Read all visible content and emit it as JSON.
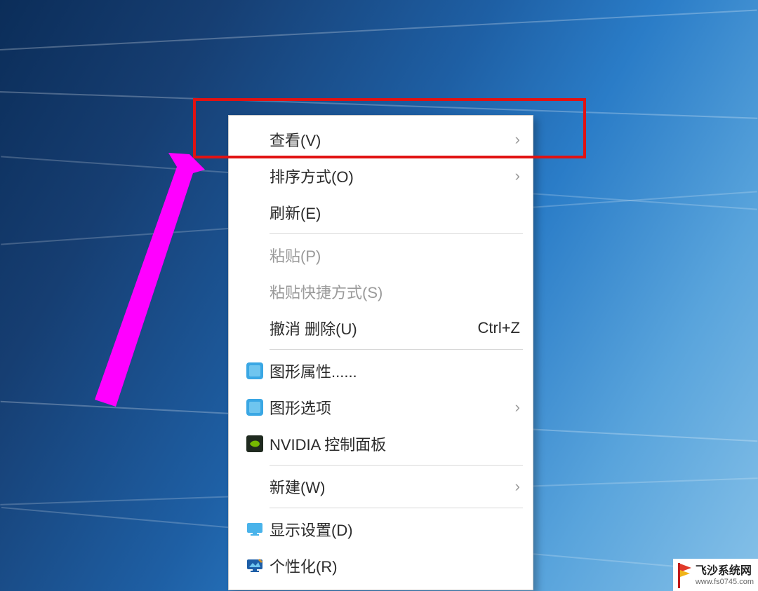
{
  "menu": {
    "items": [
      {
        "name": "menu-view",
        "label": "查看(V)",
        "icon": null,
        "submenu": true,
        "disabled": false,
        "shortcut": null
      },
      {
        "name": "menu-sort",
        "label": "排序方式(O)",
        "icon": null,
        "submenu": true,
        "disabled": false,
        "shortcut": null
      },
      {
        "name": "menu-refresh",
        "label": "刷新(E)",
        "icon": null,
        "submenu": false,
        "disabled": false,
        "shortcut": null
      },
      {
        "separator": true
      },
      {
        "name": "menu-paste",
        "label": "粘贴(P)",
        "icon": null,
        "submenu": false,
        "disabled": true,
        "shortcut": null
      },
      {
        "name": "menu-paste-shortcut",
        "label": "粘贴快捷方式(S)",
        "icon": null,
        "submenu": false,
        "disabled": true,
        "shortcut": null
      },
      {
        "name": "menu-undo-delete",
        "label": "撤消 删除(U)",
        "icon": null,
        "submenu": false,
        "disabled": false,
        "shortcut": "Ctrl+Z"
      },
      {
        "separator": true
      },
      {
        "name": "menu-graphics-properties",
        "label": "图形属性......",
        "icon": "intel-icon",
        "submenu": false,
        "disabled": false,
        "shortcut": null
      },
      {
        "name": "menu-graphics-options",
        "label": "图形选项",
        "icon": "intel-icon",
        "submenu": true,
        "disabled": false,
        "shortcut": null
      },
      {
        "name": "menu-nvidia",
        "label": "NVIDIA 控制面板",
        "icon": "nvidia-icon",
        "submenu": false,
        "disabled": false,
        "shortcut": null
      },
      {
        "separator": true
      },
      {
        "name": "menu-new",
        "label": "新建(W)",
        "icon": null,
        "submenu": true,
        "disabled": false,
        "shortcut": null
      },
      {
        "separator": true
      },
      {
        "name": "menu-display-settings",
        "label": "显示设置(D)",
        "icon": "monitor-icon",
        "submenu": false,
        "disabled": false,
        "shortcut": null
      },
      {
        "name": "menu-personalize",
        "label": "个性化(R)",
        "icon": "personalize-icon",
        "submenu": false,
        "disabled": false,
        "shortcut": null
      }
    ]
  },
  "chevron_glyph": "›",
  "annotation": {
    "highlight_target": "menu-view",
    "arrow_color": "#ff00ff"
  },
  "watermark": {
    "title": "飞沙系统网",
    "url": "www.fs0745.com"
  }
}
